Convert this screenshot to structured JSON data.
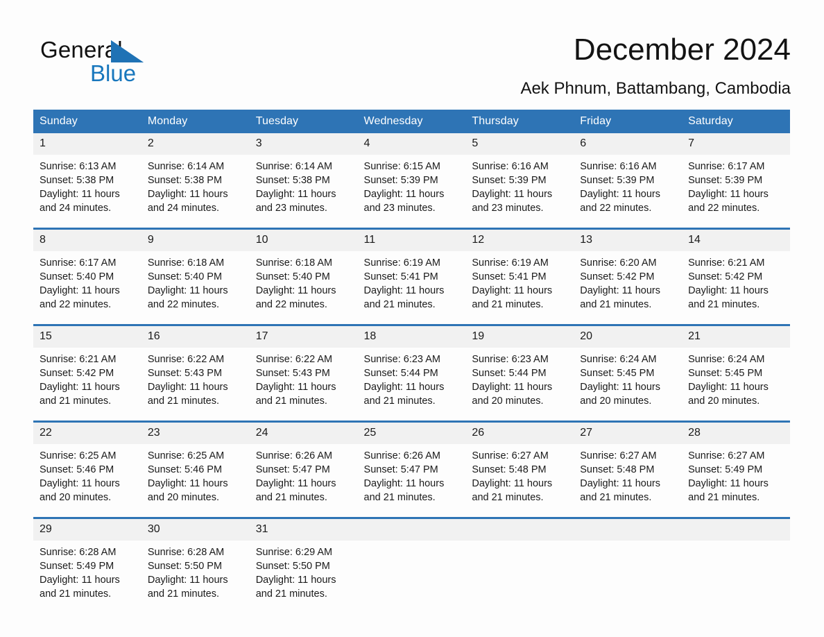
{
  "brand": {
    "name_part1": "General",
    "name_part2": "Blue",
    "triangle_color": "#1f72b5",
    "blue_color": "#1877bd"
  },
  "header": {
    "month_title": "December 2024",
    "location": "Aek Phnum, Battambang, Cambodia"
  },
  "theme": {
    "header_blue": "#2e74b5",
    "daynum_band": "#f1f1f1",
    "page_background": "#fdfdfd",
    "text": "#1a1a1a"
  },
  "weekday_headers": [
    "Sunday",
    "Monday",
    "Tuesday",
    "Wednesday",
    "Thursday",
    "Friday",
    "Saturday"
  ],
  "labels": {
    "sunrise_prefix": "Sunrise:",
    "sunset_prefix": "Sunset:",
    "daylight_prefix": "Daylight:"
  },
  "weeks": [
    {
      "days": [
        {
          "num": "1",
          "sunrise": "Sunrise: 6:13 AM",
          "sunset": "Sunset: 5:38 PM",
          "daylight_l1": "Daylight: 11 hours",
          "daylight_l2": "and 24 minutes."
        },
        {
          "num": "2",
          "sunrise": "Sunrise: 6:14 AM",
          "sunset": "Sunset: 5:38 PM",
          "daylight_l1": "Daylight: 11 hours",
          "daylight_l2": "and 24 minutes."
        },
        {
          "num": "3",
          "sunrise": "Sunrise: 6:14 AM",
          "sunset": "Sunset: 5:38 PM",
          "daylight_l1": "Daylight: 11 hours",
          "daylight_l2": "and 23 minutes."
        },
        {
          "num": "4",
          "sunrise": "Sunrise: 6:15 AM",
          "sunset": "Sunset: 5:39 PM",
          "daylight_l1": "Daylight: 11 hours",
          "daylight_l2": "and 23 minutes."
        },
        {
          "num": "5",
          "sunrise": "Sunrise: 6:16 AM",
          "sunset": "Sunset: 5:39 PM",
          "daylight_l1": "Daylight: 11 hours",
          "daylight_l2": "and 23 minutes."
        },
        {
          "num": "6",
          "sunrise": "Sunrise: 6:16 AM",
          "sunset": "Sunset: 5:39 PM",
          "daylight_l1": "Daylight: 11 hours",
          "daylight_l2": "and 22 minutes."
        },
        {
          "num": "7",
          "sunrise": "Sunrise: 6:17 AM",
          "sunset": "Sunset: 5:39 PM",
          "daylight_l1": "Daylight: 11 hours",
          "daylight_l2": "and 22 minutes."
        }
      ]
    },
    {
      "days": [
        {
          "num": "8",
          "sunrise": "Sunrise: 6:17 AM",
          "sunset": "Sunset: 5:40 PM",
          "daylight_l1": "Daylight: 11 hours",
          "daylight_l2": "and 22 minutes."
        },
        {
          "num": "9",
          "sunrise": "Sunrise: 6:18 AM",
          "sunset": "Sunset: 5:40 PM",
          "daylight_l1": "Daylight: 11 hours",
          "daylight_l2": "and 22 minutes."
        },
        {
          "num": "10",
          "sunrise": "Sunrise: 6:18 AM",
          "sunset": "Sunset: 5:40 PM",
          "daylight_l1": "Daylight: 11 hours",
          "daylight_l2": "and 22 minutes."
        },
        {
          "num": "11",
          "sunrise": "Sunrise: 6:19 AM",
          "sunset": "Sunset: 5:41 PM",
          "daylight_l1": "Daylight: 11 hours",
          "daylight_l2": "and 21 minutes."
        },
        {
          "num": "12",
          "sunrise": "Sunrise: 6:19 AM",
          "sunset": "Sunset: 5:41 PM",
          "daylight_l1": "Daylight: 11 hours",
          "daylight_l2": "and 21 minutes."
        },
        {
          "num": "13",
          "sunrise": "Sunrise: 6:20 AM",
          "sunset": "Sunset: 5:42 PM",
          "daylight_l1": "Daylight: 11 hours",
          "daylight_l2": "and 21 minutes."
        },
        {
          "num": "14",
          "sunrise": "Sunrise: 6:21 AM",
          "sunset": "Sunset: 5:42 PM",
          "daylight_l1": "Daylight: 11 hours",
          "daylight_l2": "and 21 minutes."
        }
      ]
    },
    {
      "days": [
        {
          "num": "15",
          "sunrise": "Sunrise: 6:21 AM",
          "sunset": "Sunset: 5:42 PM",
          "daylight_l1": "Daylight: 11 hours",
          "daylight_l2": "and 21 minutes."
        },
        {
          "num": "16",
          "sunrise": "Sunrise: 6:22 AM",
          "sunset": "Sunset: 5:43 PM",
          "daylight_l1": "Daylight: 11 hours",
          "daylight_l2": "and 21 minutes."
        },
        {
          "num": "17",
          "sunrise": "Sunrise: 6:22 AM",
          "sunset": "Sunset: 5:43 PM",
          "daylight_l1": "Daylight: 11 hours",
          "daylight_l2": "and 21 minutes."
        },
        {
          "num": "18",
          "sunrise": "Sunrise: 6:23 AM",
          "sunset": "Sunset: 5:44 PM",
          "daylight_l1": "Daylight: 11 hours",
          "daylight_l2": "and 21 minutes."
        },
        {
          "num": "19",
          "sunrise": "Sunrise: 6:23 AM",
          "sunset": "Sunset: 5:44 PM",
          "daylight_l1": "Daylight: 11 hours",
          "daylight_l2": "and 20 minutes."
        },
        {
          "num": "20",
          "sunrise": "Sunrise: 6:24 AM",
          "sunset": "Sunset: 5:45 PM",
          "daylight_l1": "Daylight: 11 hours",
          "daylight_l2": "and 20 minutes."
        },
        {
          "num": "21",
          "sunrise": "Sunrise: 6:24 AM",
          "sunset": "Sunset: 5:45 PM",
          "daylight_l1": "Daylight: 11 hours",
          "daylight_l2": "and 20 minutes."
        }
      ]
    },
    {
      "days": [
        {
          "num": "22",
          "sunrise": "Sunrise: 6:25 AM",
          "sunset": "Sunset: 5:46 PM",
          "daylight_l1": "Daylight: 11 hours",
          "daylight_l2": "and 20 minutes."
        },
        {
          "num": "23",
          "sunrise": "Sunrise: 6:25 AM",
          "sunset": "Sunset: 5:46 PM",
          "daylight_l1": "Daylight: 11 hours",
          "daylight_l2": "and 20 minutes."
        },
        {
          "num": "24",
          "sunrise": "Sunrise: 6:26 AM",
          "sunset": "Sunset: 5:47 PM",
          "daylight_l1": "Daylight: 11 hours",
          "daylight_l2": "and 21 minutes."
        },
        {
          "num": "25",
          "sunrise": "Sunrise: 6:26 AM",
          "sunset": "Sunset: 5:47 PM",
          "daylight_l1": "Daylight: 11 hours",
          "daylight_l2": "and 21 minutes."
        },
        {
          "num": "26",
          "sunrise": "Sunrise: 6:27 AM",
          "sunset": "Sunset: 5:48 PM",
          "daylight_l1": "Daylight: 11 hours",
          "daylight_l2": "and 21 minutes."
        },
        {
          "num": "27",
          "sunrise": "Sunrise: 6:27 AM",
          "sunset": "Sunset: 5:48 PM",
          "daylight_l1": "Daylight: 11 hours",
          "daylight_l2": "and 21 minutes."
        },
        {
          "num": "28",
          "sunrise": "Sunrise: 6:27 AM",
          "sunset": "Sunset: 5:49 PM",
          "daylight_l1": "Daylight: 11 hours",
          "daylight_l2": "and 21 minutes."
        }
      ]
    },
    {
      "days": [
        {
          "num": "29",
          "sunrise": "Sunrise: 6:28 AM",
          "sunset": "Sunset: 5:49 PM",
          "daylight_l1": "Daylight: 11 hours",
          "daylight_l2": "and 21 minutes."
        },
        {
          "num": "30",
          "sunrise": "Sunrise: 6:28 AM",
          "sunset": "Sunset: 5:50 PM",
          "daylight_l1": "Daylight: 11 hours",
          "daylight_l2": "and 21 minutes."
        },
        {
          "num": "31",
          "sunrise": "Sunrise: 6:29 AM",
          "sunset": "Sunset: 5:50 PM",
          "daylight_l1": "Daylight: 11 hours",
          "daylight_l2": "and 21 minutes."
        },
        {
          "num": "",
          "sunrise": "",
          "sunset": "",
          "daylight_l1": "",
          "daylight_l2": ""
        },
        {
          "num": "",
          "sunrise": "",
          "sunset": "",
          "daylight_l1": "",
          "daylight_l2": ""
        },
        {
          "num": "",
          "sunrise": "",
          "sunset": "",
          "daylight_l1": "",
          "daylight_l2": ""
        },
        {
          "num": "",
          "sunrise": "",
          "sunset": "",
          "daylight_l1": "",
          "daylight_l2": ""
        }
      ]
    }
  ]
}
